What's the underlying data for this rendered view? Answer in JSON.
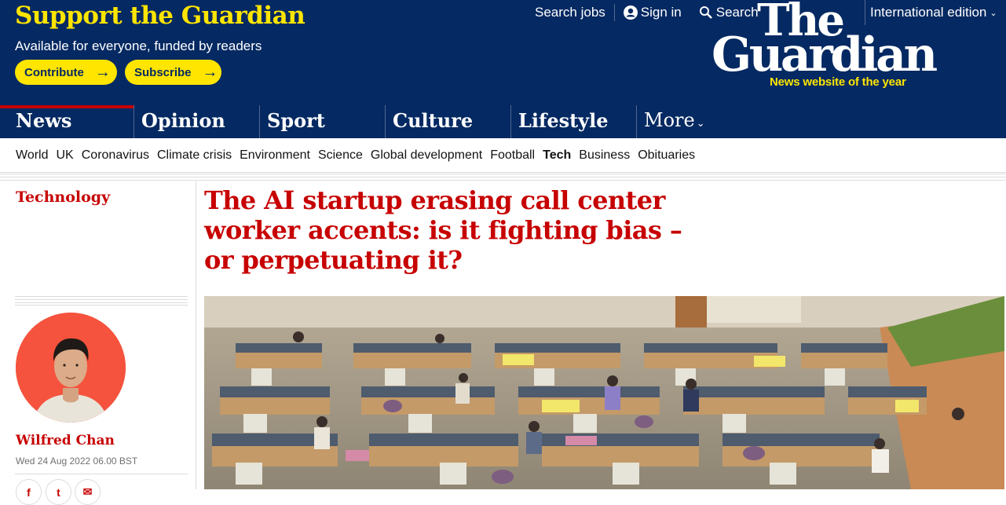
{
  "support": {
    "title": "Support the Guardian",
    "subtitle": "Available for everyone, funded by readers",
    "contribute_label": "Contribute",
    "subscribe_label": "Subscribe",
    "arrow": "→"
  },
  "top_links": {
    "search_jobs": "Search jobs",
    "sign_in": "Sign in",
    "search": "Search",
    "edition": "International edition",
    "edition_chevron": "⌄"
  },
  "logo": {
    "line1": "The",
    "line2": "Guardian",
    "tagline": "News website of the year"
  },
  "pillars": [
    {
      "label": "News",
      "active": true
    },
    {
      "label": "Opinion"
    },
    {
      "label": "Sport"
    },
    {
      "label": "Culture"
    },
    {
      "label": "Lifestyle"
    },
    {
      "label": "More"
    }
  ],
  "subnav": [
    "World",
    "UK",
    "Coronavirus",
    "Climate crisis",
    "Environment",
    "Science",
    "Global development",
    "Football",
    "Tech",
    "Business",
    "Obituaries"
  ],
  "article": {
    "section": "Technology",
    "headline": "The AI startup erasing call center worker accents: is it fighting bias – or perpetuating it?",
    "author": "Wilfred Chan",
    "date": "Wed 24 Aug 2022 06.00 BST"
  },
  "share": {
    "facebook": "f",
    "twitter": "t",
    "email": "✉"
  },
  "colors": {
    "brand": "#052962",
    "accent": "#ffe500",
    "news_red": "#c70000",
    "avatar_bg": "#f5533d"
  },
  "icons": [
    "user-icon",
    "search-icon",
    "chevron-down-icon",
    "arrow-right-icon",
    "facebook-icon",
    "twitter-icon",
    "email-icon"
  ]
}
